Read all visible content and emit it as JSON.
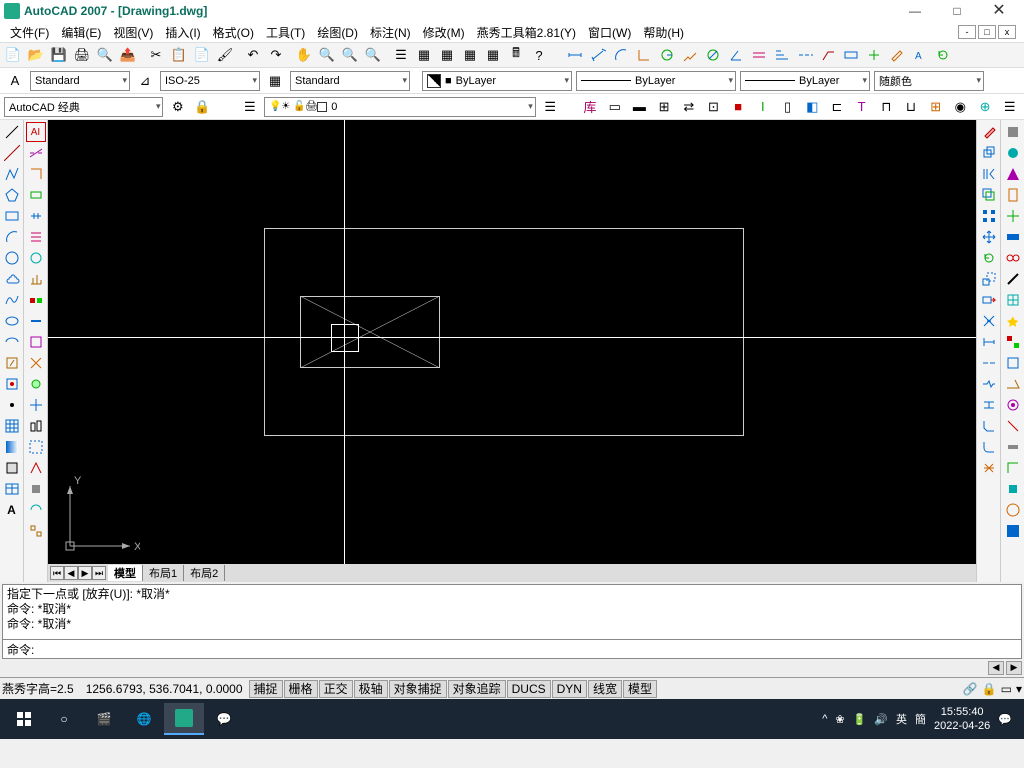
{
  "title": "AutoCAD 2007 - [Drawing1.dwg]",
  "menu": [
    "文件(F)",
    "编辑(E)",
    "视图(V)",
    "插入(I)",
    "格式(O)",
    "工具(T)",
    "绘图(D)",
    "标注(N)",
    "修改(M)",
    "燕秀工具箱2.81(Y)",
    "窗口(W)",
    "帮助(H)"
  ],
  "styles": {
    "textStyle": "Standard",
    "dimStyle": "ISO-25",
    "tableStyle": "Standard"
  },
  "props": {
    "colorLabel": "ByLayer",
    "linetype": "ByLayer",
    "lineweight": "ByLayer",
    "plotstyle": "随颜色"
  },
  "workspace": "AutoCAD 经典",
  "layer": "0",
  "tabs": {
    "model": "模型",
    "layout1": "布局1",
    "layout2": "布局2"
  },
  "cmd": {
    "l1": "指定下一点或 [放弃(U)]: *取消*",
    "l2": "命令: *取消*",
    "l3": "命令: *取消*",
    "prompt": "命令:"
  },
  "status": {
    "textheight": "燕秀字高=2.5",
    "coords": "1256.6793, 536.7041, 0.0000",
    "toggles": [
      "捕捉",
      "栅格",
      "正交",
      "极轴",
      "对象捕捉",
      "对象追踪",
      "DUCS",
      "DYN",
      "线宽",
      "模型"
    ]
  },
  "ucs": {
    "x": "X",
    "y": "Y"
  },
  "tray": {
    "ime1": "英",
    "ime2": "簡",
    "time": "15:55:40",
    "date": "2022-04-26"
  }
}
